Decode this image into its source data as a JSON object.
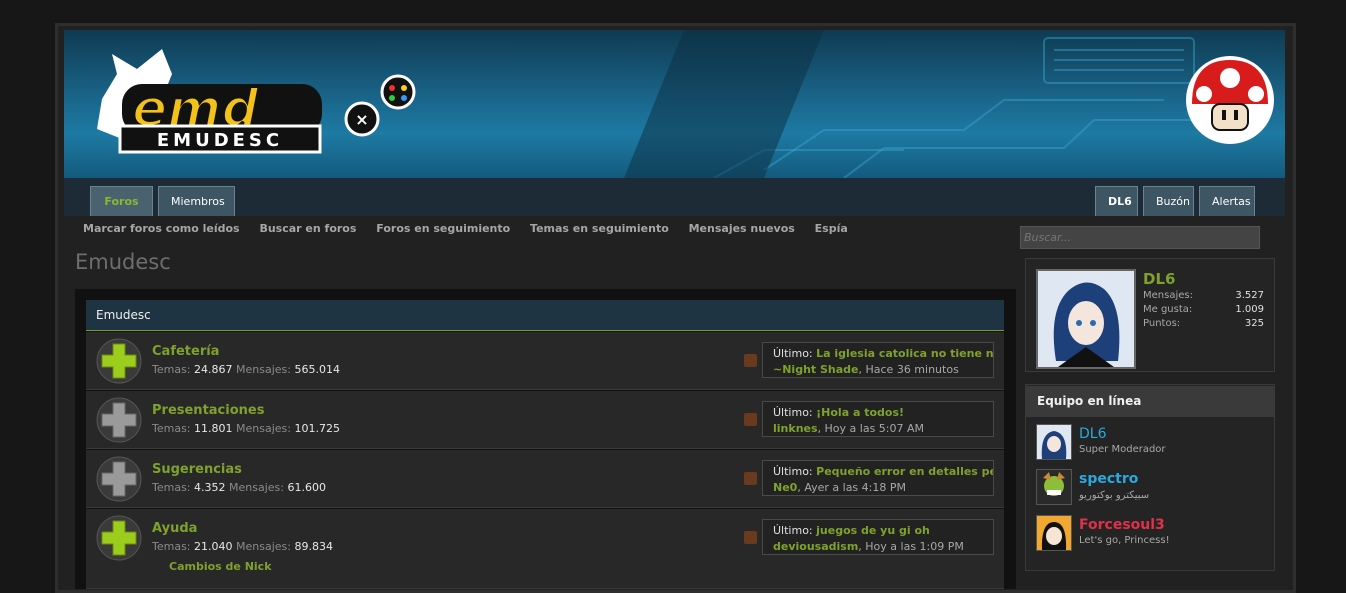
{
  "header": {
    "logo_text": "emd",
    "logo_sub": "EMUDESC"
  },
  "nav": {
    "tabs_left": [
      "Foros",
      "Miembros"
    ],
    "tabs_right": [
      "DL6",
      "Buzón",
      "Alertas"
    ],
    "subnav": [
      "Marcar foros como leídos",
      "Buscar en foros",
      "Foros en seguimiento",
      "Temas en seguimiento",
      "Mensajes nuevos",
      "Espía"
    ]
  },
  "search": {
    "placeholder": "Buscar..."
  },
  "page_title": "Emudesc",
  "category": {
    "title": "Emudesc"
  },
  "nodes": [
    {
      "title": "Cafetería",
      "temas_label": "Temas:",
      "temas": "24.867",
      "mensajes_label": "Mensajes:",
      "mensajes": "565.014",
      "last_label": "Último:",
      "last_title": "La iglesia catolica no tiene na...",
      "last_user": "~Night Shade",
      "last_time": ", Hace 36 minutos",
      "unread": true
    },
    {
      "title": "Presentaciones",
      "temas_label": "Temas:",
      "temas": "11.801",
      "mensajes_label": "Mensajes:",
      "mensajes": "101.725",
      "last_label": "Último:",
      "last_title": "¡Hola a todos!",
      "last_user": "linknes",
      "last_time": ", Hoy a las 5:07 AM",
      "unread": false
    },
    {
      "title": "Sugerencias",
      "temas_label": "Temas:",
      "temas": "4.352",
      "mensajes_label": "Mensajes:",
      "mensajes": "61.600",
      "last_label": "Último:",
      "last_title": "Pequeño error en detalles pe...",
      "last_user": "Ne0",
      "last_time": ", Ayer a las 4:18 PM",
      "unread": false
    },
    {
      "title": "Ayuda",
      "temas_label": "Temas:",
      "temas": "21.040",
      "mensajes_label": "Mensajes:",
      "mensajes": "89.834",
      "last_label": "Último:",
      "last_title": "juegos de yu gi oh",
      "last_user": "deviousadism",
      "last_time": ", Hoy a las 1:09 PM",
      "unread": true
    }
  ],
  "subforum": "Cambios de Nick",
  "visitor": {
    "name": "DL6",
    "stats": [
      {
        "label": "Mensajes:",
        "value": "3.527"
      },
      {
        "label": "Me gusta:",
        "value": "1.009"
      },
      {
        "label": "Puntos:",
        "value": "325"
      }
    ]
  },
  "team": {
    "title": "Equipo en línea",
    "members": [
      {
        "name": "DL6",
        "role": "Super Moderador",
        "color": "#2aa8e0"
      },
      {
        "name": "spectro",
        "role": "سبيكترو بوكتوريو",
        "color": "#2aa8e0"
      },
      {
        "name": "Forcesoul3",
        "role": "Let's go, Princess!",
        "color": "#e0304a"
      }
    ]
  },
  "colors": {
    "accent": "#7ea22c",
    "header": "#1a6489"
  }
}
